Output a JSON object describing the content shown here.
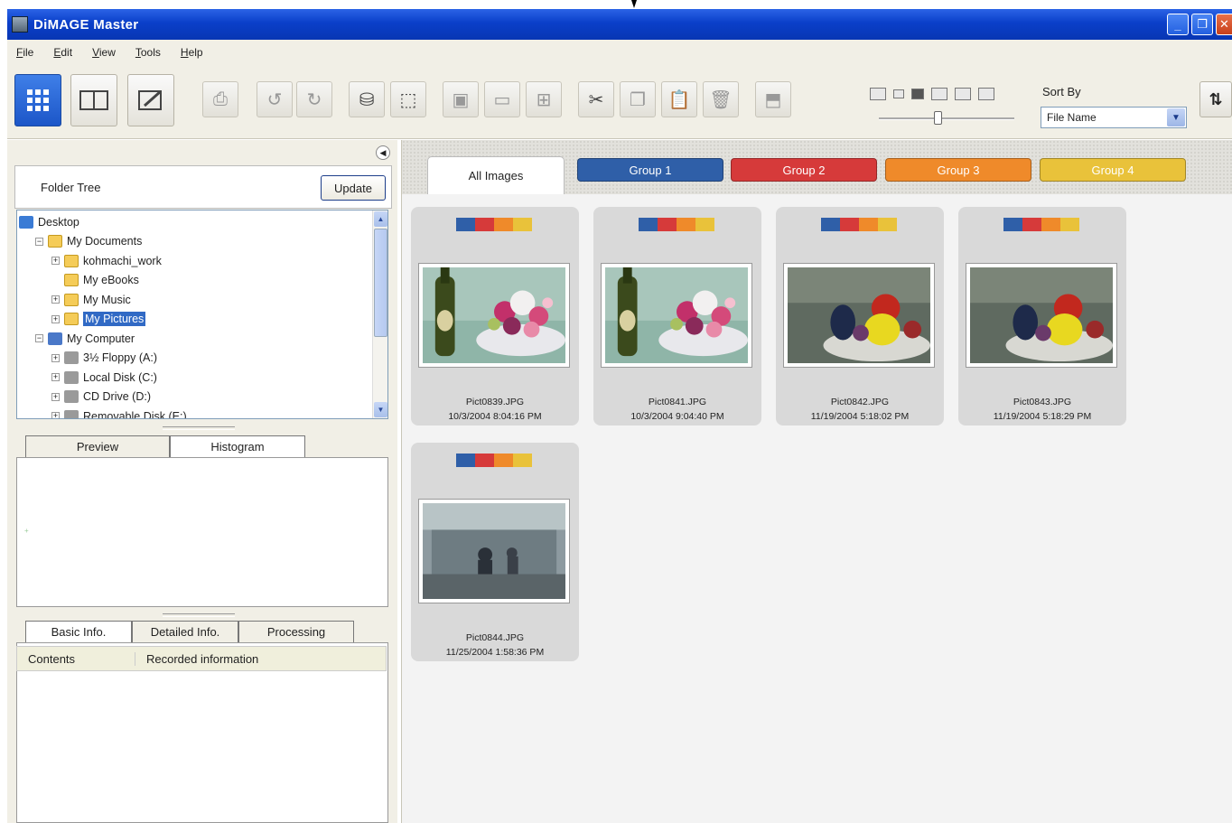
{
  "window": {
    "title": "DiMAGE Master"
  },
  "menu": [
    "File",
    "Edit",
    "View",
    "Tools",
    "Help"
  ],
  "toolbar": {
    "sort_by_label": "Sort By",
    "sort_by_value": "File Name"
  },
  "folder_tree": {
    "label": "Folder Tree",
    "update_label": "Update",
    "items": [
      {
        "label": "Desktop",
        "level": 0,
        "icon": "desktop-icon",
        "expander": ""
      },
      {
        "label": "My Documents",
        "level": 1,
        "icon": "folder-icon",
        "expander": "−"
      },
      {
        "label": "kohmachi_work",
        "level": 2,
        "icon": "folder-icon",
        "expander": "+"
      },
      {
        "label": "My eBooks",
        "level": 2,
        "icon": "folder-icon",
        "expander": ""
      },
      {
        "label": "My Music",
        "level": 2,
        "icon": "folder-icon",
        "expander": "+"
      },
      {
        "label": "My Pictures",
        "level": 2,
        "icon": "folder-icon",
        "expander": "+",
        "selected": true
      },
      {
        "label": "My Computer",
        "level": 1,
        "icon": "computer-icon",
        "expander": "−"
      },
      {
        "label": "3½ Floppy (A:)",
        "level": 2,
        "icon": "drive-icon",
        "expander": "+"
      },
      {
        "label": "Local Disk (C:)",
        "level": 2,
        "icon": "drive-icon",
        "expander": "+"
      },
      {
        "label": "CD Drive (D:)",
        "level": 2,
        "icon": "drive-icon",
        "expander": "+"
      },
      {
        "label": "Removable Disk (E:)",
        "level": 2,
        "icon": "drive-icon",
        "expander": "+"
      }
    ]
  },
  "preview_tabs": {
    "preview": "Preview",
    "histogram": "Histogram"
  },
  "info_tabs": {
    "basic": "Basic Info.",
    "detailed": "Detailed Info.",
    "processing": "Processing"
  },
  "info_table": {
    "col1": "Contents",
    "col2": "Recorded information"
  },
  "groups": {
    "all": "All Images",
    "g1": "Group 1",
    "g2": "Group 2",
    "g3": "Group 3",
    "g4": "Group 4"
  },
  "colors": {
    "group1": "#2f5fa8",
    "group2": "#d63a3a",
    "group3": "#ef8a2a",
    "group4": "#e9c23a"
  },
  "images": [
    {
      "name": "Pict0839.JPG",
      "date": "10/3/2004 8:04:16 PM",
      "scene": "flowers"
    },
    {
      "name": "Pict0841.JPG",
      "date": "10/3/2004 9:04:40 PM",
      "scene": "flowers"
    },
    {
      "name": "Pict0842.JPG",
      "date": "11/19/2004 5:18:02 PM",
      "scene": "fruit"
    },
    {
      "name": "Pict0843.JPG",
      "date": "11/19/2004 5:18:29 PM",
      "scene": "fruit"
    },
    {
      "name": "Pict0844.JPG",
      "date": "11/25/2004 1:58:36 PM",
      "scene": "kitchen"
    }
  ]
}
